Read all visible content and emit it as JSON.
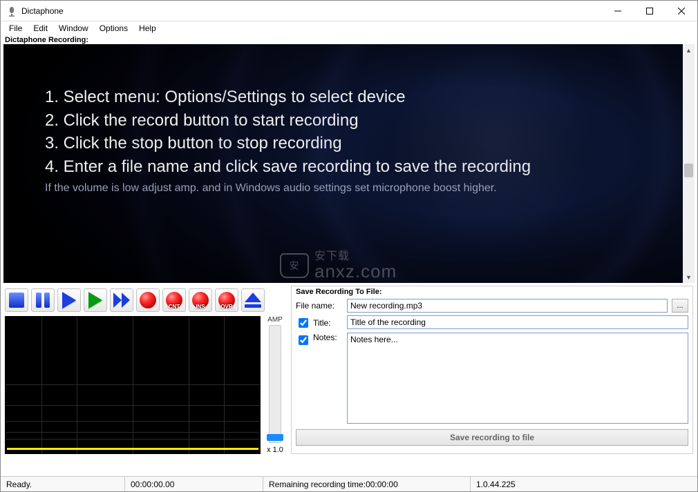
{
  "window": {
    "title": "Dictaphone"
  },
  "menu": {
    "items": [
      "File",
      "Edit",
      "Window",
      "Options",
      "Help"
    ]
  },
  "recording_label": "Dictaphone Recording:",
  "instructions": {
    "lines": [
      "1. Select menu: Options/Settings to select device",
      "2. Click the record button to start recording",
      "3. Click the stop button to stop recording",
      "4. Enter a file name and click save recording to save the recording"
    ],
    "hint": "If the volume is low adjust amp. and in Windows audio settings set microphone boost higher."
  },
  "watermark": {
    "badge": "安",
    "text_top": "安下载",
    "text": "anxz.com"
  },
  "transport": {
    "record_cnt_label": "CNT",
    "record_ins_label": "INS",
    "record_ovr_label": "OVR"
  },
  "amp": {
    "label": "AMP",
    "value": "x 1.0"
  },
  "save_panel": {
    "title": "Save Recording To File:",
    "filename_label": "File name:",
    "filename_value": "New recording.mp3",
    "browse_label": "...",
    "title_checkbox_checked": true,
    "title_label": "Title:",
    "title_value": "Title of the recording",
    "notes_checkbox_checked": true,
    "notes_label": "Notes:",
    "notes_value": "Notes here...",
    "save_button": "Save recording to file"
  },
  "status": {
    "ready": "Ready.",
    "elapsed": "00:00:00.00",
    "remaining_label": "Remaining recording time: ",
    "remaining_value": "00:00:00",
    "version": "1.0.44.225"
  }
}
